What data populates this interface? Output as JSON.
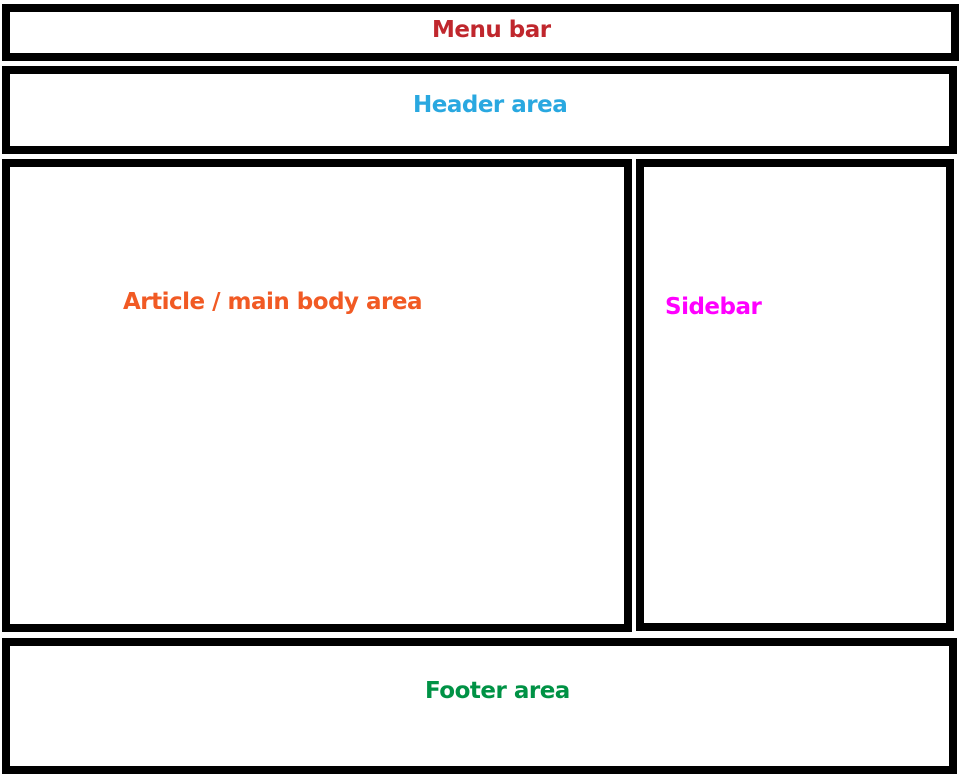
{
  "regions": {
    "menu_bar": {
      "label": "Menu bar",
      "color": "#c0272d"
    },
    "header": {
      "label": "Header area",
      "color": "#29a8e0"
    },
    "article": {
      "label": "Article / main body area",
      "color": "#f15a24"
    },
    "sidebar": {
      "label": "Sidebar",
      "color": "#ff00ff"
    },
    "footer": {
      "label": "Footer area",
      "color": "#009245"
    }
  },
  "border_color": "#000000"
}
